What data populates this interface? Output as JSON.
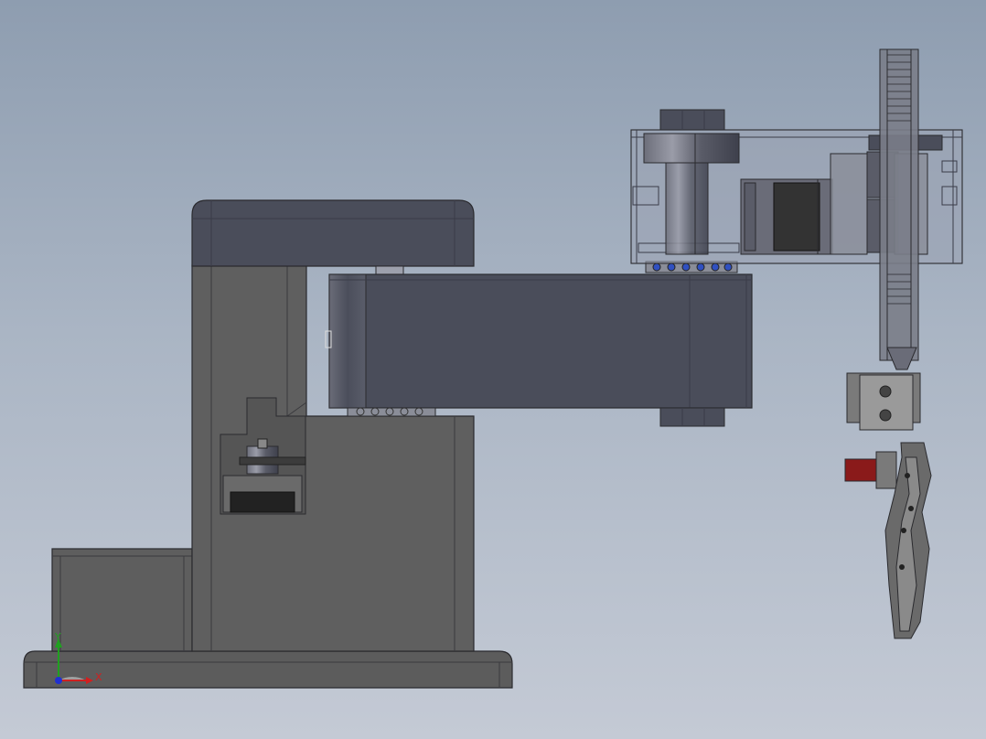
{
  "viewport": {
    "background_top": "#8e9db0",
    "background_bottom": "#c4cad5"
  },
  "model": {
    "body_color": "#5e5e5e",
    "arm_color": "#4a4d5a",
    "edge_color": "#2a2a2e",
    "translucent_color": "#9aa3b2",
    "bearing_accent": "#3050c0",
    "gripper_color": "#6a6a6a",
    "motor_accent": "#8a1a1a"
  },
  "triad": {
    "x_label": "X",
    "y_label": "Y",
    "x_color": "#d02020",
    "y_color": "#20a020",
    "z_color": "#2030d0"
  }
}
